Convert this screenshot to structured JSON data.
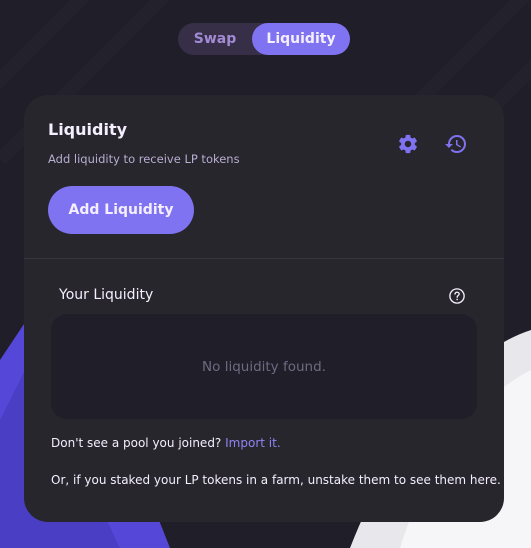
{
  "nav": {
    "swap_label": "Swap",
    "liquidity_label": "Liquidity"
  },
  "card": {
    "title": "Liquidity",
    "subtitle": "Add liquidity to receive LP tokens",
    "add_button": "Add Liquidity",
    "settings_icon": "gear-icon",
    "history_icon": "history-icon"
  },
  "your_liquidity": {
    "heading": "Your Liquidity",
    "help_icon": "question-circle-icon",
    "empty_text": "No liquidity found."
  },
  "footer": {
    "pool_prompt": "Don't see a pool you joined?",
    "import_link": "Import it.",
    "farm_note": "Or, if you staked your LP tokens in a farm, unstake them to see them here."
  },
  "colors": {
    "background": "#1f1e29",
    "card": "#27262c",
    "accent": "#7f73f1",
    "text": "#f4eeff",
    "link": "#8f84f3"
  }
}
